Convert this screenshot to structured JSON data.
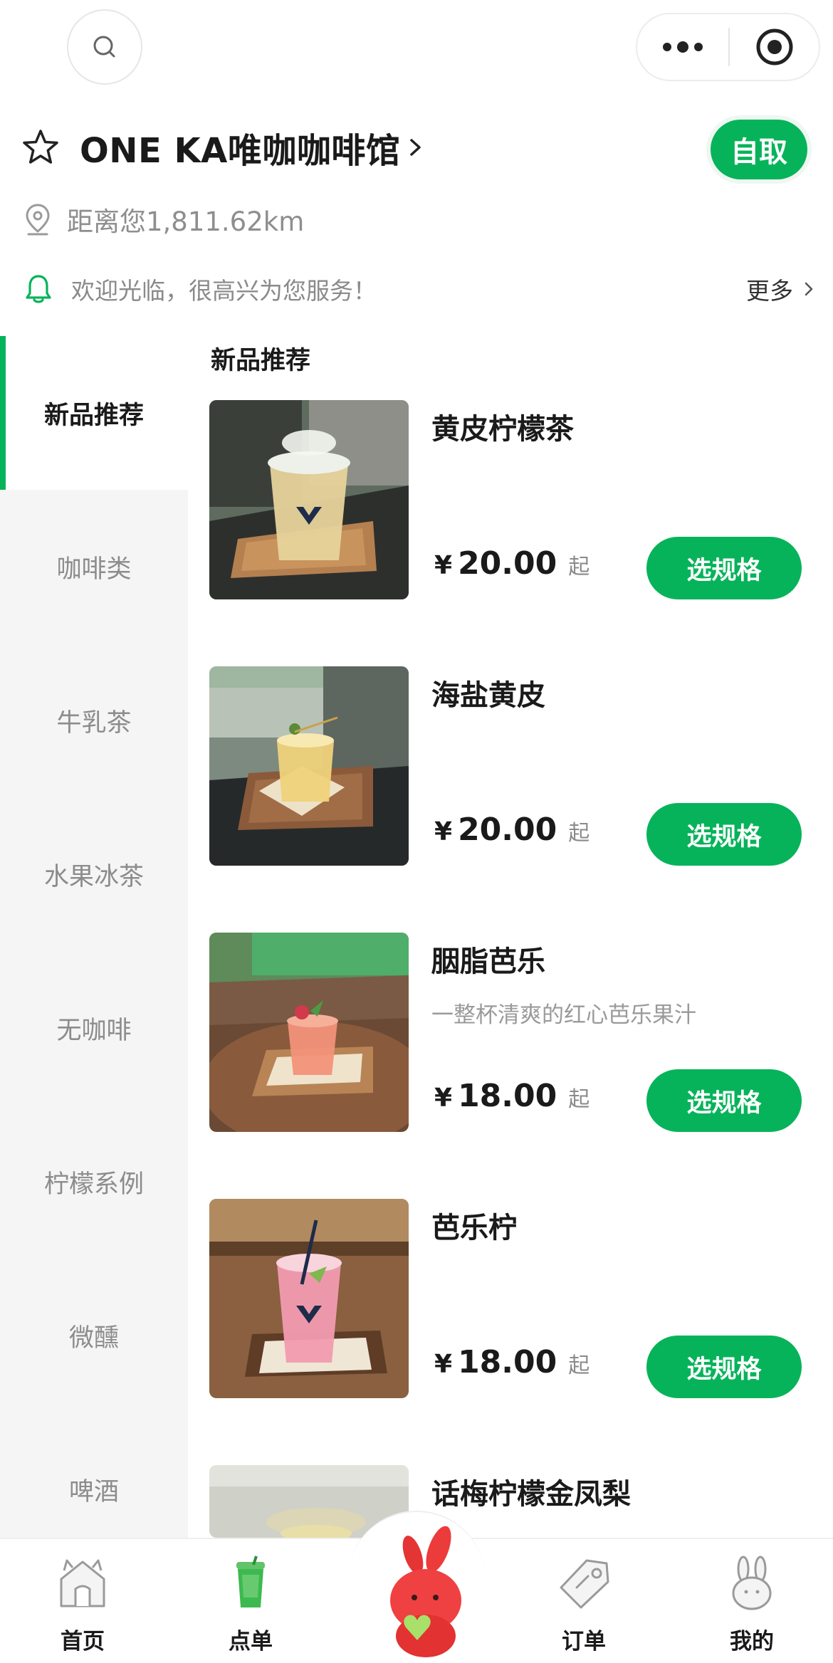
{
  "store": {
    "name": "ONE KA唯咖咖啡馆",
    "pickup_label": "自取",
    "distance": "距离您1,811.62km",
    "notice": "欢迎光临，很高兴为您服务！",
    "more_label": "更多"
  },
  "categories": [
    {
      "label": "新品推荐",
      "active": true
    },
    {
      "label": "咖啡类"
    },
    {
      "label": "牛乳茶"
    },
    {
      "label": "水果冰茶"
    },
    {
      "label": "无咖啡"
    },
    {
      "label": "柠檬系例"
    },
    {
      "label": "微醺"
    },
    {
      "label": "啤酒"
    }
  ],
  "section_title": "新品推荐",
  "products": [
    {
      "name": "黄皮柠檬茶",
      "desc": "",
      "currency": "¥",
      "price": "20.00",
      "suffix": "起",
      "button": "选规格"
    },
    {
      "name": "海盐黄皮",
      "desc": "",
      "currency": "¥",
      "price": "20.00",
      "suffix": "起",
      "button": "选规格"
    },
    {
      "name": "胭脂芭乐",
      "desc": "一整杯清爽的红心芭乐果汁",
      "currency": "¥",
      "price": "18.00",
      "suffix": "起",
      "button": "选规格"
    },
    {
      "name": "芭乐柠",
      "desc": "",
      "currency": "¥",
      "price": "18.00",
      "suffix": "起",
      "button": "选规格"
    },
    {
      "name": "话梅柠檬金凤梨",
      "desc": ""
    }
  ],
  "tabs": [
    {
      "label": "首页",
      "icon": "home-icon"
    },
    {
      "label": "点单",
      "icon": "cup-icon"
    },
    {
      "label": "订单",
      "icon": "tag-icon"
    },
    {
      "label": "我的",
      "icon": "bunny-icon"
    }
  ],
  "colors": {
    "accent": "#07b35a",
    "sidebar_bg": "#f5f5f5",
    "muted_text": "#8c8c8c"
  }
}
